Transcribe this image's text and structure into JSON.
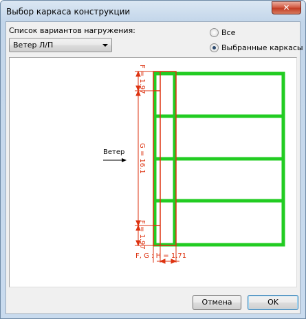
{
  "window": {
    "title": "Выбор каркаса конструкции",
    "close_glyph": "✕"
  },
  "load_list": {
    "label": "Список вариантов нагружения:",
    "selected": "Ветер Л/П"
  },
  "scope": {
    "options": [
      {
        "label": "Все",
        "checked": false
      },
      {
        "label": "Выбранные каркасы",
        "checked": true
      }
    ]
  },
  "diagram": {
    "wind_label": "Ветер",
    "dims": {
      "f_top": "F = 1.97",
      "g_mid": "G = 16.1",
      "f_bottom": "F = 1.97",
      "bottom_label": "F, G : H = 1.71"
    },
    "colors": {
      "frame": "#22cc22",
      "dims": "#dd3311"
    }
  },
  "buttons": {
    "cancel": "Отмена",
    "ok": "OK"
  }
}
